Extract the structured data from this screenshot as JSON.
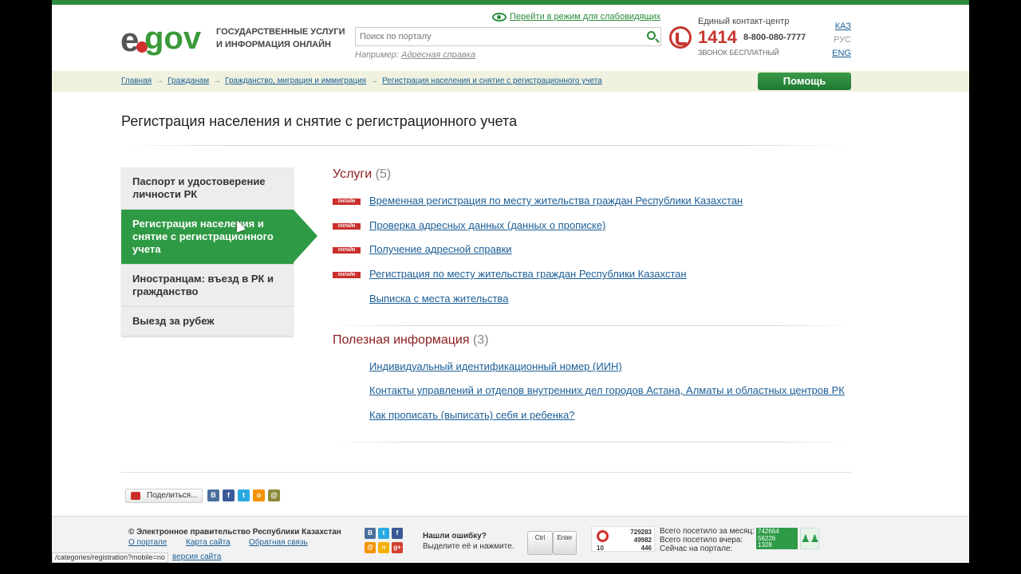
{
  "header": {
    "logo_e": "e",
    "logo_gov": "gov",
    "tagline": "ГОСУДАРСТВЕННЫЕ УСЛУГИ И ИНФОРМАЦИЯ ОНЛАЙН",
    "vision_link": "Перейти в режим для слабовидящих",
    "search_placeholder": "Поиск по порталу",
    "example_label": "Например:",
    "example_link": "Адресная справка",
    "contact_title": "Единый контакт-центр",
    "contact_short": "1414",
    "contact_long": "8-800-080-7777",
    "contact_free": "ЗВОНОК БЕСПЛАТНЫЙ",
    "languages": [
      "КАЗ",
      "РУС",
      "ENG"
    ],
    "active_language": "РУС"
  },
  "breadcrumb": [
    "Главная",
    "Гражданам",
    "Гражданство, миграция и иммиграция",
    "Регистрация населения и снятие с регистрационного учета"
  ],
  "help_button": "Помощь",
  "page_title": "Регистрация населения и снятие с регистрационного учета",
  "sidebar": [
    {
      "label": "Паспорт и удостоверение личности РК"
    },
    {
      "label": "Регистрация населения и снятие с регистрационного учета"
    },
    {
      "label": "Иностранцам: въезд в РК и гражданство"
    },
    {
      "label": "Выезд за рубеж"
    }
  ],
  "services": {
    "title": "Услуги",
    "count": "(5)",
    "badge": "ОНЛАЙН",
    "items": [
      {
        "label": "Временная регистрация по месту жительства граждан Республики Казахстан",
        "online": true
      },
      {
        "label": "Проверка адресных данных (данных о прописке)",
        "online": true
      },
      {
        "label": "Получение адресной справки",
        "online": true
      },
      {
        "label": "Регистрация по месту жительства граждан Республики Казахстан",
        "online": true
      },
      {
        "label": "Выписка с места жительства",
        "online": false
      }
    ]
  },
  "useful": {
    "title": "Полезная информация",
    "count": "(3)",
    "items": [
      "Индивидуальный идентификационный номер (ИИН)",
      "Контакты управлений и отделов внутренних дел городов Астана, Алматы и областных центров РК",
      "Как прописать (выписать) себя и ребенка?"
    ]
  },
  "share": {
    "label": "Поделиться...",
    "icons": [
      "В",
      "f",
      "t",
      "о",
      "@"
    ]
  },
  "footer": {
    "copyright": "© Электронное правительство Республики Казахстан",
    "links": [
      "О портале",
      "Карта сайта",
      "Обратная связь"
    ],
    "url_tooltip": "/categories/registration?mobile=no",
    "mobile_version": "версия сайта",
    "social_icons": [
      "В",
      "t",
      "f",
      "@",
      "ч",
      "g+"
    ],
    "error_title": "Нашли ошибку?",
    "error_text": "Выделите её и нажмите.",
    "key_ctrl": "Ctrl",
    "key_enter": "Enter",
    "counter": {
      "v1": "729283",
      "v2": "49982",
      "v3": "446",
      "v0": "10"
    },
    "visits_month_label": "Всего посетило за месяц:",
    "visits_yesterday_label": "Всего посетило вчера:",
    "visits_now_label": "Сейчас на портале:",
    "visits_month": "742664",
    "visits_yesterday": "56226",
    "visits_now": "1328"
  },
  "colors": {
    "brand_green": "#2f9a45",
    "link_blue": "#1b5e96",
    "heading_red": "#8b1e1e",
    "badge_red": "#c9302c"
  }
}
